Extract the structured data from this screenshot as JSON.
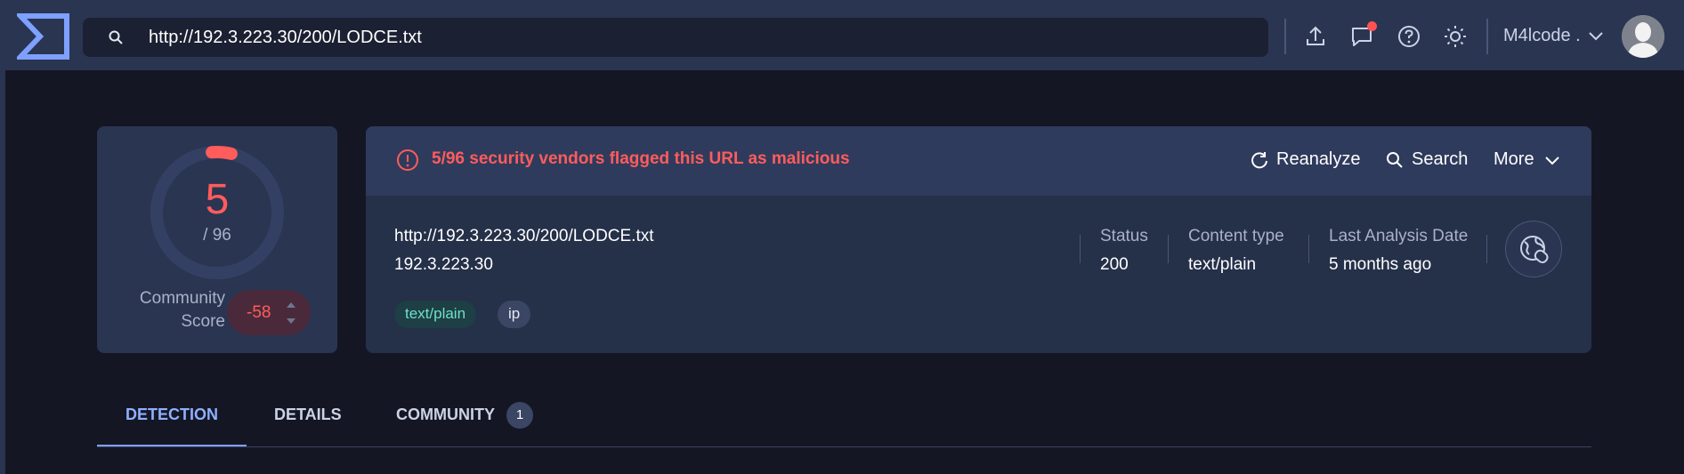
{
  "topbar": {
    "url": "http://192.3.223.30/200/LODCE.txt",
    "user_name": "M4lcode .",
    "icons": [
      "upload-icon",
      "chat-icon",
      "help-icon",
      "theme-icon"
    ]
  },
  "score": {
    "detections": "5",
    "total": "/ 96",
    "community_label": "Community Score",
    "community_value": "-58"
  },
  "alert": {
    "text": "5/96 security vendors flagged this URL as malicious"
  },
  "actions": {
    "reanalyze": "Reanalyze",
    "search": "Search",
    "more": "More"
  },
  "target": {
    "url": "http://192.3.223.30/200/LODCE.txt",
    "ip": "192.3.223.30",
    "tags": [
      "text/plain",
      "ip"
    ]
  },
  "meta": {
    "status_label": "Status",
    "status_value": "200",
    "content_type_label": "Content type",
    "content_type_value": "text/plain",
    "last_analysis_label": "Last Analysis Date",
    "last_analysis_value": "5 months ago"
  },
  "tabs": [
    {
      "label": "DETECTION",
      "active": true
    },
    {
      "label": "DETAILS",
      "active": false
    },
    {
      "label": "COMMUNITY",
      "active": false,
      "badge": "1"
    }
  ],
  "colors": {
    "malicious": "#ff5c5c",
    "accent": "#7ea0ff",
    "background": "#151624",
    "card": "#2a3552"
  }
}
